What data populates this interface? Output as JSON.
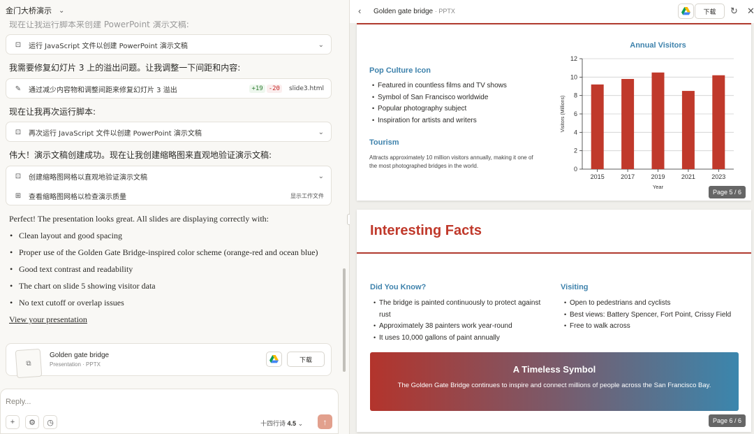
{
  "left": {
    "title": "金门大桥演示",
    "cut_msg": "现在让我运行脚本来创建 PowerPoint 演示文稿:",
    "tool1": "运行 JavaScript 文件以创建 PowerPoint 演示文稿",
    "msg2": "我需要修复幻灯片 3 上的溢出问题。让我调整一下间距和内容:",
    "tool2": {
      "label": "通过减少内容物和调整间距来修复幻灯片 3 溢出",
      "add": "+19",
      "del": "-20",
      "file": "slide3.html"
    },
    "msg3": "现在让我再次运行脚本:",
    "tool3": "再次运行 JavaScript 文件以创建 PowerPoint 演示文稿",
    "msg4": "伟大！演示文稿创建成功。现在让我创建缩略图来直观地验证演示文稿:",
    "tool4a": "创建缩略图网格以直观地验证演示文稿",
    "tool4b": "查看缩略图网格以检查演示质量",
    "tool4b_right": "显示工作文件",
    "summary_intro": "Perfect! The presentation looks great. All slides are displaying correctly with:",
    "summary_items": [
      "Clean layout and good spacing",
      "Proper use of the Golden Gate Bridge-inspired color scheme (orange-red and ocean blue)",
      "Good text contrast and readability",
      "The chart on slide 5 showing visitor data",
      "No text cutoff or overlap issues"
    ],
    "link": "View your presentation",
    "file": {
      "title": "Golden gate bridge",
      "sub": "Presentation · PPTX",
      "download": "下载"
    },
    "composer": {
      "placeholder": "Reply...",
      "model_name": "十四行诗",
      "model_ver": "4.5"
    }
  },
  "right": {
    "title": "Golden gate bridge",
    "type": "· PPTX",
    "download": "下载",
    "slide5": {
      "h_pop": "Pop Culture Icon",
      "pop_items": [
        "Featured in countless films and TV shows",
        "Symbol of San Francisco worldwide",
        "Popular photography subject",
        "Inspiration for artists and writers"
      ],
      "h_tourism": "Tourism",
      "tourism_text": "Attracts approximately 10 million visitors annually, making it one of the most photographed bridges in the world.",
      "page": "Page 5 / 6"
    },
    "slide6": {
      "title": "Interesting Facts",
      "h_know": "Did You Know?",
      "know_items": [
        "The bridge is painted continuously to protect against rust",
        "Approximately 38 painters work year-round",
        "It uses 10,000 gallons of paint annually"
      ],
      "h_visit": "Visiting",
      "visit_items": [
        "Open to pedestrians and cyclists",
        "Best views: Battery Spencer, Fort Point, Crissy Field",
        "Free to walk across"
      ],
      "banner_title": "A Timeless Symbol",
      "banner_text": "The Golden Gate Bridge continues to inspire and connect millions of people across the San Francisco Bay.",
      "page": "Page 6 / 6"
    }
  },
  "chart_data": {
    "type": "bar",
    "title": "Annual Visitors",
    "xlabel": "Year",
    "ylabel": "Visitors (Millions)",
    "categories": [
      "2015",
      "2017",
      "2019",
      "2021",
      "2023"
    ],
    "values": [
      9.2,
      9.8,
      10.5,
      8.5,
      10.2
    ],
    "ylim": [
      0,
      12
    ],
    "yticks": [
      0,
      2,
      4,
      6,
      8,
      10,
      12
    ],
    "bar_color": "#c0392b",
    "grid": true
  }
}
